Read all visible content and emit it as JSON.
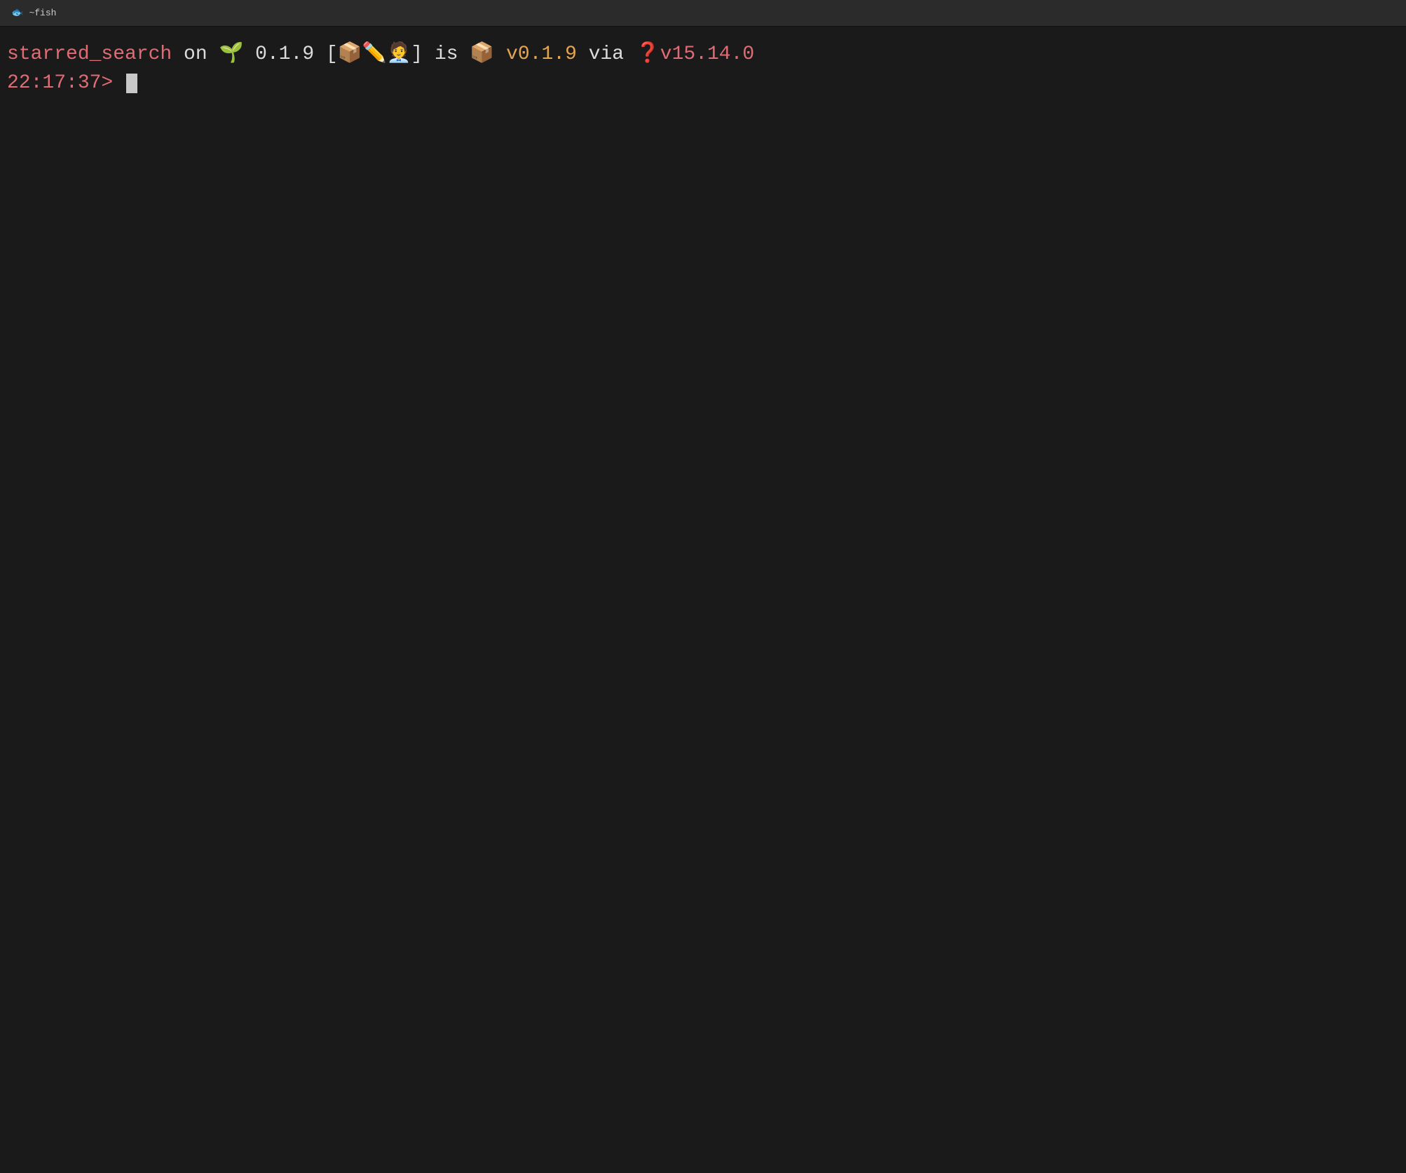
{
  "titleBar": {
    "icon": "🐟",
    "text": "~fish"
  },
  "terminal": {
    "promptLine1": {
      "projectName": "starred_search",
      "on": " on ",
      "branchIcon": "🌱",
      "branchVersion": " 0.1.9 ",
      "statusIcons": "[📦✏️🧑‍💼]",
      "is": " is ",
      "packageIcon": "📦",
      "packageVersion": " v0.1.9",
      "via": " via ",
      "nodeIcon": "❓",
      "nodeVersion": "v15.14.0"
    },
    "promptLine2": {
      "time": "22:17:37",
      "prompt": "> "
    }
  },
  "colors": {
    "background": "#1a1a1a",
    "titleBar": "#2b2b2b",
    "salmon": "#e06c75",
    "white": "#dcdcdc",
    "green": "#4ec94e",
    "orange": "#e5a550",
    "darkOrange": "#d4703a",
    "gray": "#aaaaaa",
    "cursor": "#c8c8c8"
  }
}
